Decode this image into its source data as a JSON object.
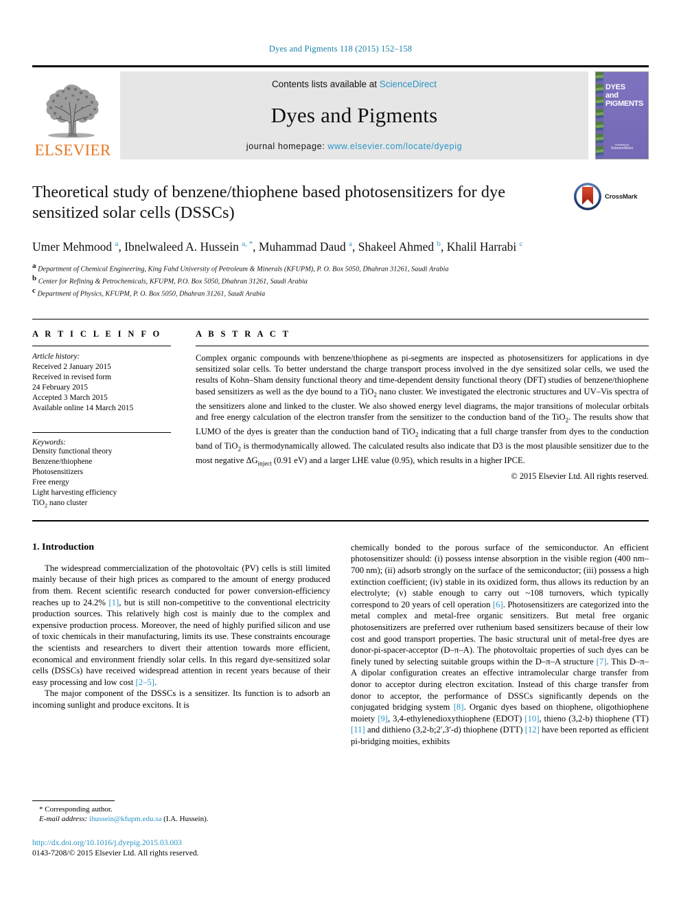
{
  "running_head": "Dyes and Pigments 118 (2015) 152–158",
  "journal_header": {
    "publisher_wordmark": "ELSEVIER",
    "contents_prefix": "Contents lists available at ",
    "contents_link": "ScienceDirect",
    "journal_name": "Dyes and Pigments",
    "homepage_prefix": "journal homepage: ",
    "homepage_url": "www.elsevier.com/locate/dyepig",
    "cover": {
      "line1": "DYES",
      "line2": "and",
      "line3": "PIGMENTS",
      "footer_small": "Published by",
      "footer_brand": "ScienceDirect"
    }
  },
  "article": {
    "title": "Theoretical study of benzene/thiophene based photosensitizers for dye sensitized solar cells (DSSCs)",
    "crossmark_label": "CrossMark",
    "authors_html": "Umer Mehmood <sup>a</sup>, Ibnelwaleed A. Hussein <sup>a, *</sup>, Muhammad Daud <sup>a</sup>, Shakeel Ahmed <sup>b</sup>, Khalil Harrabi <sup>c</sup>",
    "affiliations": [
      {
        "mark": "a",
        "text": "Department of Chemical Engineering, King Fahd University of Petroleum & Minerals (KFUPM), P. O. Box 5050, Dhahran 31261, Saudi Arabia"
      },
      {
        "mark": "b",
        "text": "Center for Refining & Petrochemicals, KFUPM, P.O. Box 5050, Dhahran 31261, Saudi Arabia"
      },
      {
        "mark": "c",
        "text": "Department of Physics, KFUPM, P. O. Box 5050, Dhahran 31261, Saudi Arabia"
      }
    ]
  },
  "article_info": {
    "heading": "A R T I C L E   I N F O",
    "history_label": "Article history:",
    "history": [
      "Received 2 January 2015",
      "Received in revised form",
      "24 February 2015",
      "Accepted 3 March 2015",
      "Available online 14 March 2015"
    ],
    "keywords_label": "Keywords:",
    "keywords": [
      "Density functional theory",
      "Benzene/thiophene",
      "Photosensitizers",
      "Free energy",
      "Light harvesting efficiency",
      "TiO2 nano cluster"
    ]
  },
  "abstract": {
    "heading": "A B S T R A C T",
    "text_html": "Complex organic compounds with benzene/thiophene as pi-segments are inspected as photosensitizers for applications in dye sensitized solar cells. To better understand the charge transport process involved in the dye sensitized solar cells, we used the results of Kohn–Sham density functional theory and time-dependent density functional theory (DFT) studies of benzene/thiophene based sensitizers as well as the dye bound to a TiO<sub>2</sub> nano cluster. We investigated the electronic structures and UV–Vis spectra of the sensitizers alone and linked to the cluster. We also showed energy level diagrams, the major transitions of molecular orbitals and free energy calculation of the electron transfer from the sensitizer to the conduction band of the TiO<sub>2</sub>. The results show that LUMO of the dyes is greater than the conduction band of TiO<sub>2</sub> indicating that a full charge transfer from dyes to the conduction band of TiO<sub>2</sub> is thermodynamically allowed. The calculated results also indicate that D3 is the most plausible sensitizer due to the most negative ΔG<sub>inject</sub> (0.91 eV) and a larger LHE value (0.95), which results in a higher IPCE.",
    "copyright": "© 2015 Elsevier Ltd. All rights reserved."
  },
  "body": {
    "section_heading": "1. Introduction",
    "left_paragraphs_html": [
      "The widespread commercialization of the photovoltaic (PV) cells is still limited mainly because of their high prices as compared to the amount of energy produced from them. Recent scientific research conducted for power conversion-efficiency reaches up to 24.2% <span class=\"cite\">[1]</span>, but is still non-competitive to the conventional electricity production sources. This relatively high cost is mainly due to the complex and expensive production process. Moreover, the need of highly purified silicon and use of toxic chemicals in their manufacturing, limits its use. These constraints encourage the scientists and researchers to divert their attention towards more efficient, economical and environment friendly solar cells. In this regard dye-sensitized solar cells (DSSCs) have received widespread attention in recent years because of their easy processing and low cost <span class=\"cite\">[2–5]</span>.",
      "The major component of the DSSCs is a sensitizer. Its function is to adsorb an incoming sunlight and produce excitons. It is"
    ],
    "right_paragraphs_html": [
      "chemically bonded to the porous surface of the semiconductor. An efficient photosensitizer should: (i) possess intense absorption in the visible region (400 nm–700 nm); (ii) adsorb strongly on the surface of the semiconductor; (iii) possess a high extinction coefficient; (iv) stable in its oxidized form, thus allows its reduction by an electrolyte; (v) stable enough to carry out ~108 turnovers, which typically correspond to 20 years of cell operation <span class=\"cite\">[6]</span>. Photosensitizers are categorized into the metal complex and metal-free organic sensitizers. But metal free organic photosensitizers are preferred over ruthenium based sensitizers because of their low cost and good transport properties. The basic structural unit of metal-free dyes are donor-pi-spacer-acceptor (D–π–A). The photovoltaic properties of such dyes can be finely tuned by selecting suitable groups within the D–π–A structure <span class=\"cite\">[7]</span>. This D–π–A dipolar configuration creates an effective intramolecular charge transfer from donor to acceptor during electron excitation. Instead of this charge transfer from donor to acceptor, the performance of DSSCs significantly depends on the conjugated bridging system <span class=\"cite\">[8]</span>. Organic dyes based on thiophene, oligothiophene moiety <span class=\"cite\">[9]</span>, 3,4-ethylenedioxythiophene (EDOT) <span class=\"cite\">[10]</span>, thieno (3,2-b) thiophene (TT) <span class=\"cite\">[11]</span> and dithieno (3,2-b;2′,3′-d) thiophene (DTT) <span class=\"cite\">[12]</span> have been reported as efficient pi-bridging moities, exhibits"
    ]
  },
  "footnotes": {
    "corresponding": "* Corresponding author.",
    "email_label": "E-mail address:",
    "email": "ihussein@kfupm.edu.sa",
    "email_suffix": "(I.A. Hussein).",
    "doi_url": "http://dx.doi.org/10.1016/j.dyepig.2015.03.003",
    "issn_line": "0143-7208/© 2015 Elsevier Ltd. All rights reserved."
  },
  "colors": {
    "link_blue": "#2a94c4",
    "elsevier_orange": "#E87722",
    "band_gray": "#e6e6e6",
    "cover_purple": "#7a6fbb"
  }
}
